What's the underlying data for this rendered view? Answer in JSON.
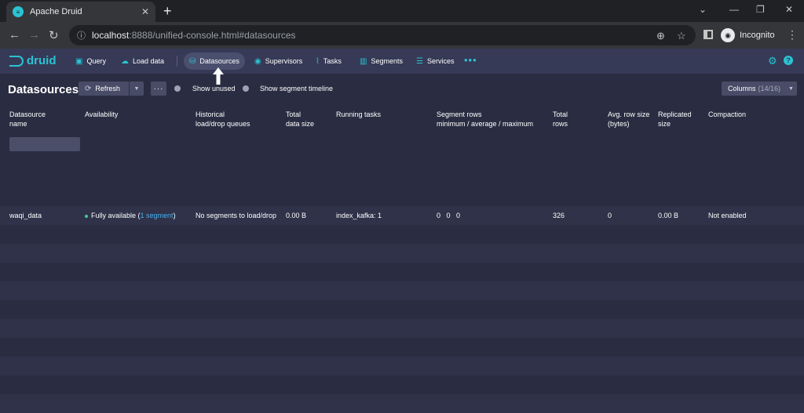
{
  "browser": {
    "tab_title": "Apache Druid",
    "url_host": "localhost",
    "url_rest": ":8888/unified-console.html#datasources",
    "profile_label": "Incognito"
  },
  "nav": {
    "logo_text": "druid",
    "items": [
      {
        "label": "Query",
        "icon": "query-icon"
      },
      {
        "label": "Load data",
        "icon": "load-data-icon"
      },
      {
        "label": "Datasources",
        "icon": "datasources-icon"
      },
      {
        "label": "Supervisors",
        "icon": "supervisors-icon"
      },
      {
        "label": "Tasks",
        "icon": "tasks-icon"
      },
      {
        "label": "Segments",
        "icon": "segments-icon"
      },
      {
        "label": "Services",
        "icon": "services-icon"
      }
    ],
    "more": "•••"
  },
  "controls": {
    "title": "Datasources",
    "refresh_label": "Refresh",
    "show_unused": "Show unused",
    "show_timeline": "Show segment timeline",
    "columns_label": "Columns",
    "columns_count": "(14/16)"
  },
  "table": {
    "headers": [
      [
        "Datasource",
        "name"
      ],
      [
        "Availability",
        ""
      ],
      [
        "Historical",
        "load/drop queues"
      ],
      [
        "Total",
        "data size"
      ],
      [
        "Running tasks",
        ""
      ],
      [
        "Segment rows",
        "minimum / average / maximum"
      ],
      [
        "Total",
        "rows"
      ],
      [
        "Avg. row size",
        "(bytes)"
      ],
      [
        "Replicated",
        "size"
      ],
      [
        "Compaction",
        ""
      ]
    ],
    "row": {
      "name": "waqi_data",
      "availability_prefix": "Fully available (",
      "availability_link": "1 segment",
      "availability_suffix": ")",
      "queues": "No segments to load/drop",
      "data_size": "0.00 B",
      "running_tasks": "index_kafka: 1",
      "segment_rows": "0   0   0",
      "total_rows": "326",
      "avg_row_size": "0",
      "replicated_size": "0.00 B",
      "compaction": "Not enabled"
    }
  },
  "colors": {
    "accent": "#2bc3d3",
    "nav_bg": "#363a56",
    "app_bg": "#2a2d42",
    "available": "#3dcc91",
    "link": "#48aff0"
  }
}
